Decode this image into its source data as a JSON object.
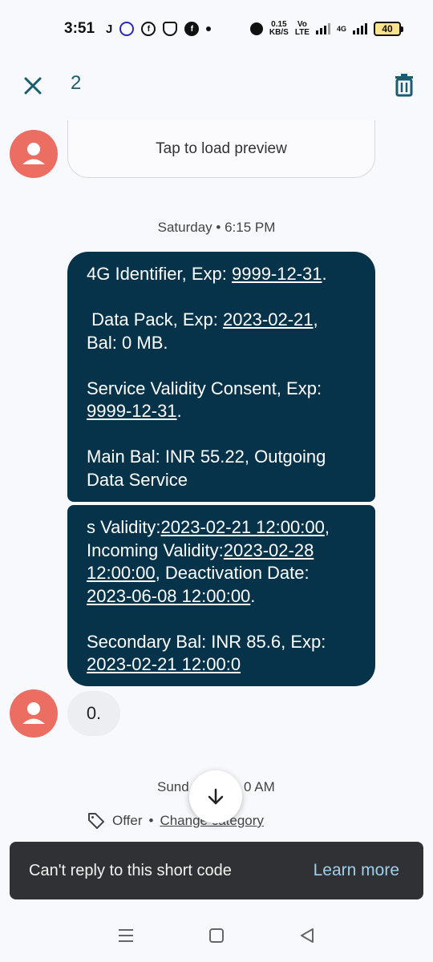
{
  "status_bar": {
    "time": "3:51",
    "net_speed_top": "0.15",
    "net_speed_bottom": "KB/S",
    "volte_top": "Vo",
    "volte_bottom": "LTE",
    "network": "4G",
    "battery": "40"
  },
  "action_bar": {
    "selected_count": "2"
  },
  "conversation": {
    "preview_text": "Tap to load preview",
    "timestamp_1": "Saturday • 6:15 PM",
    "message_1": {
      "l1a": "4G Identifier, Exp: ",
      "l1_link": "9999-12-31",
      "l1b": ".",
      "l2a": " Data Pack, Exp: ",
      "l2_link": "2023-02-21",
      "l2b": ",",
      "l3": "Bal: 0 MB.",
      "l4": "Service Validity Consent, Exp:",
      "l5_link": "9999-12-31",
      "l5b": ".",
      "l6": "Main Bal: INR 55.22, Outgoing",
      "l7": "Data Service"
    },
    "message_2": {
      "l1a": "s Validity:",
      "l1_link": "2023-02-21 12:00:00",
      "l1b": ",",
      "l2a": "Incoming Validity:",
      "l2_link": "2023-02-28",
      "l3_link": "12:00:00",
      "l3b": ", Deactivation Date:",
      "l4_link": "2023-06-08 12:00:00",
      "l4b": ".",
      "l5": "Secondary Bal: INR 85.6, Exp:",
      "l6_link": "2023-02-21 12:00:0"
    },
    "message_3": "0.",
    "timestamp_2_left": "Sund",
    "timestamp_2_right": "0 AM",
    "category_label": "Offer",
    "category_sep": "•",
    "change_category": "Change category"
  },
  "snackbar": {
    "text": "Can't reply to this short code",
    "action": "Learn more"
  },
  "colors": {
    "accent": "#1a5c70",
    "bubble_out": "#063349",
    "avatar": "#ec6e63"
  }
}
